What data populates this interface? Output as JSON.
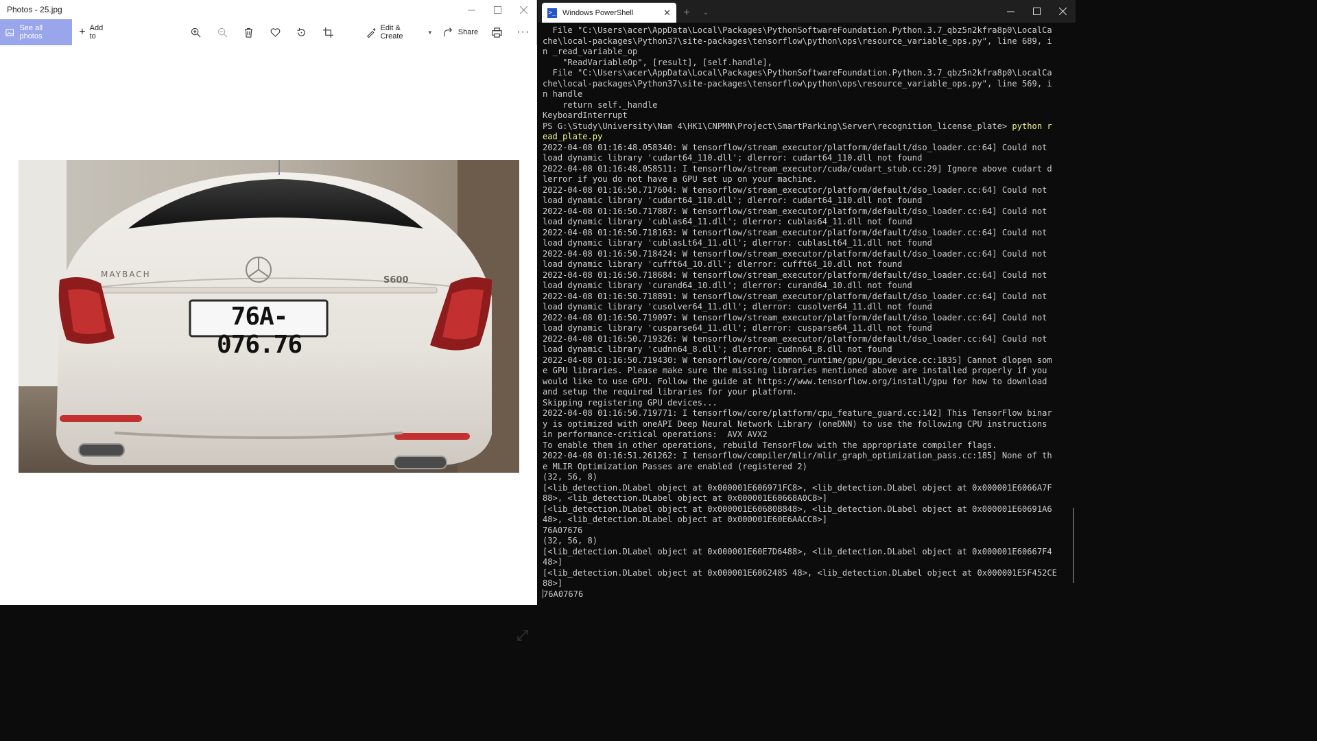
{
  "photos_window": {
    "title": "Photos - 25.jpg",
    "toolbar": {
      "see_all_label": "See all photos",
      "add_to_label": "Add to",
      "edit_create_label": "Edit & Create",
      "share_label": "Share"
    },
    "photo": {
      "car_badge_left": "MAYBACH",
      "car_badge_right": "S600",
      "license_plate": "76A-076.76"
    }
  },
  "terminal": {
    "tab_title": "Windows PowerShell",
    "prompt": "PS G:\\Study\\University\\Nam 4\\HK1\\CNPMN\\Project\\SmartParking\\Server\\recognition_license_plate> ",
    "command_part1": "python r",
    "command_part2": "ead_plate.py",
    "lines_before": [
      "  File \"C:\\Users\\acer\\AppData\\Local\\Packages\\PythonSoftwareFoundation.Python.3.7_qbz5n2kfra8p0\\LocalCa",
      "che\\local-packages\\Python37\\site-packages\\tensorflow\\python\\ops\\resource_variable_ops.py\", line 689, i",
      "n _read_variable_op",
      "    \"ReadVariableOp\", [result], [self.handle],",
      "  File \"C:\\Users\\acer\\AppData\\Local\\Packages\\PythonSoftwareFoundation.Python.3.7_qbz5n2kfra8p0\\LocalCa",
      "che\\local-packages\\Python37\\site-packages\\tensorflow\\python\\ops\\resource_variable_ops.py\", line 569, i",
      "n handle",
      "    return self._handle",
      "KeyboardInterrupt"
    ],
    "lines_after": [
      "2022-04-08 01:16:48.058340: W tensorflow/stream_executor/platform/default/dso_loader.cc:64] Could not",
      "load dynamic library 'cudart64_110.dll'; dlerror: cudart64_110.dll not found",
      "2022-04-08 01:16:48.058511: I tensorflow/stream_executor/cuda/cudart_stub.cc:29] Ignore above cudart d",
      "lerror if you do not have a GPU set up on your machine.",
      "2022-04-08 01:16:50.717604: W tensorflow/stream_executor/platform/default/dso_loader.cc:64] Could not",
      "load dynamic library 'cudart64_110.dll'; dlerror: cudart64_110.dll not found",
      "2022-04-08 01:16:50.717887: W tensorflow/stream_executor/platform/default/dso_loader.cc:64] Could not",
      "load dynamic library 'cublas64_11.dll'; dlerror: cublas64_11.dll not found",
      "2022-04-08 01:16:50.718163: W tensorflow/stream_executor/platform/default/dso_loader.cc:64] Could not",
      "load dynamic library 'cublasLt64_11.dll'; dlerror: cublasLt64_11.dll not found",
      "2022-04-08 01:16:50.718424: W tensorflow/stream_executor/platform/default/dso_loader.cc:64] Could not",
      "load dynamic library 'cufft64_10.dll'; dlerror: cufft64_10.dll not found",
      "2022-04-08 01:16:50.718684: W tensorflow/stream_executor/platform/default/dso_loader.cc:64] Could not",
      "load dynamic library 'curand64_10.dll'; dlerror: curand64_10.dll not found",
      "2022-04-08 01:16:50.718891: W tensorflow/stream_executor/platform/default/dso_loader.cc:64] Could not",
      "load dynamic library 'cusolver64_11.dll'; dlerror: cusolver64_11.dll not found",
      "2022-04-08 01:16:50.719097: W tensorflow/stream_executor/platform/default/dso_loader.cc:64] Could not",
      "load dynamic library 'cusparse64_11.dll'; dlerror: cusparse64_11.dll not found",
      "2022-04-08 01:16:50.719326: W tensorflow/stream_executor/platform/default/dso_loader.cc:64] Could not",
      "load dynamic library 'cudnn64_8.dll'; dlerror: cudnn64_8.dll not found",
      "2022-04-08 01:16:50.719430: W tensorflow/core/common_runtime/gpu/gpu_device.cc:1835] Cannot dlopen som",
      "e GPU libraries. Please make sure the missing libraries mentioned above are installed properly if you",
      "would like to use GPU. Follow the guide at https://www.tensorflow.org/install/gpu for how to download",
      "and setup the required libraries for your platform.",
      "Skipping registering GPU devices...",
      "2022-04-08 01:16:50.719771: I tensorflow/core/platform/cpu_feature_guard.cc:142] This TensorFlow binar",
      "y is optimized with oneAPI Deep Neural Network Library (oneDNN) to use the following CPU instructions",
      "in performance-critical operations:  AVX AVX2",
      "To enable them in other operations, rebuild TensorFlow with the appropriate compiler flags.",
      "2022-04-08 01:16:51.261262: I tensorflow/compiler/mlir/mlir_graph_optimization_pass.cc:185] None of th",
      "e MLIR Optimization Passes are enabled (registered 2)",
      "(32, 56, 8)",
      "[<lib_detection.DLabel object at 0x000001E606971FC8>, <lib_detection.DLabel object at 0x000001E6066A7F",
      "88>, <lib_detection.DLabel object at 0x000001E60668A0C8>]",
      "[<lib_detection.DLabel object at 0x000001E60680B848>, <lib_detection.DLabel object at 0x000001E60691A6",
      "48>, <lib_detection.DLabel object at 0x000001E60E6AACC8>]",
      "76A07676",
      "(32, 56, 8)",
      "[<lib_detection.DLabel object at 0x000001E60E7D6488>, <lib_detection.DLabel object at 0x000001E60667F4",
      "48>]",
      "[<lib_detection.DLabel object at 0x000001E6062485 48>, <lib_detection.DLabel object at 0x000001E5F452CE",
      "88>]"
    ],
    "last_line": "76A07676"
  }
}
